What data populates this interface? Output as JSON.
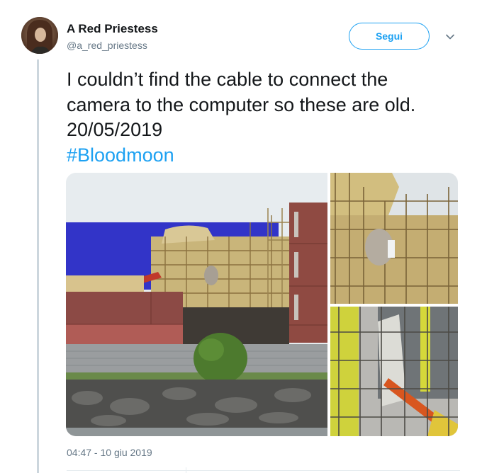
{
  "tweet": {
    "author": {
      "display_name": "A Red Priestess",
      "handle": "@a_red_priestess"
    },
    "follow_label": "Segui",
    "text_lines": [
      "I couldn’t find the cable to connect the",
      "camera to the computer so these are old.",
      "20/05/2019"
    ],
    "hashtag": "#Bloodmoon",
    "timestamp": "04:47 - 10 giu 2019",
    "photo_count": 3
  },
  "colors": {
    "accent": "#1da1f2",
    "text": "#14171a",
    "muted": "#657786",
    "thread_line": "#ccd6dd"
  },
  "icons": {
    "more": "chevron-down-icon"
  }
}
